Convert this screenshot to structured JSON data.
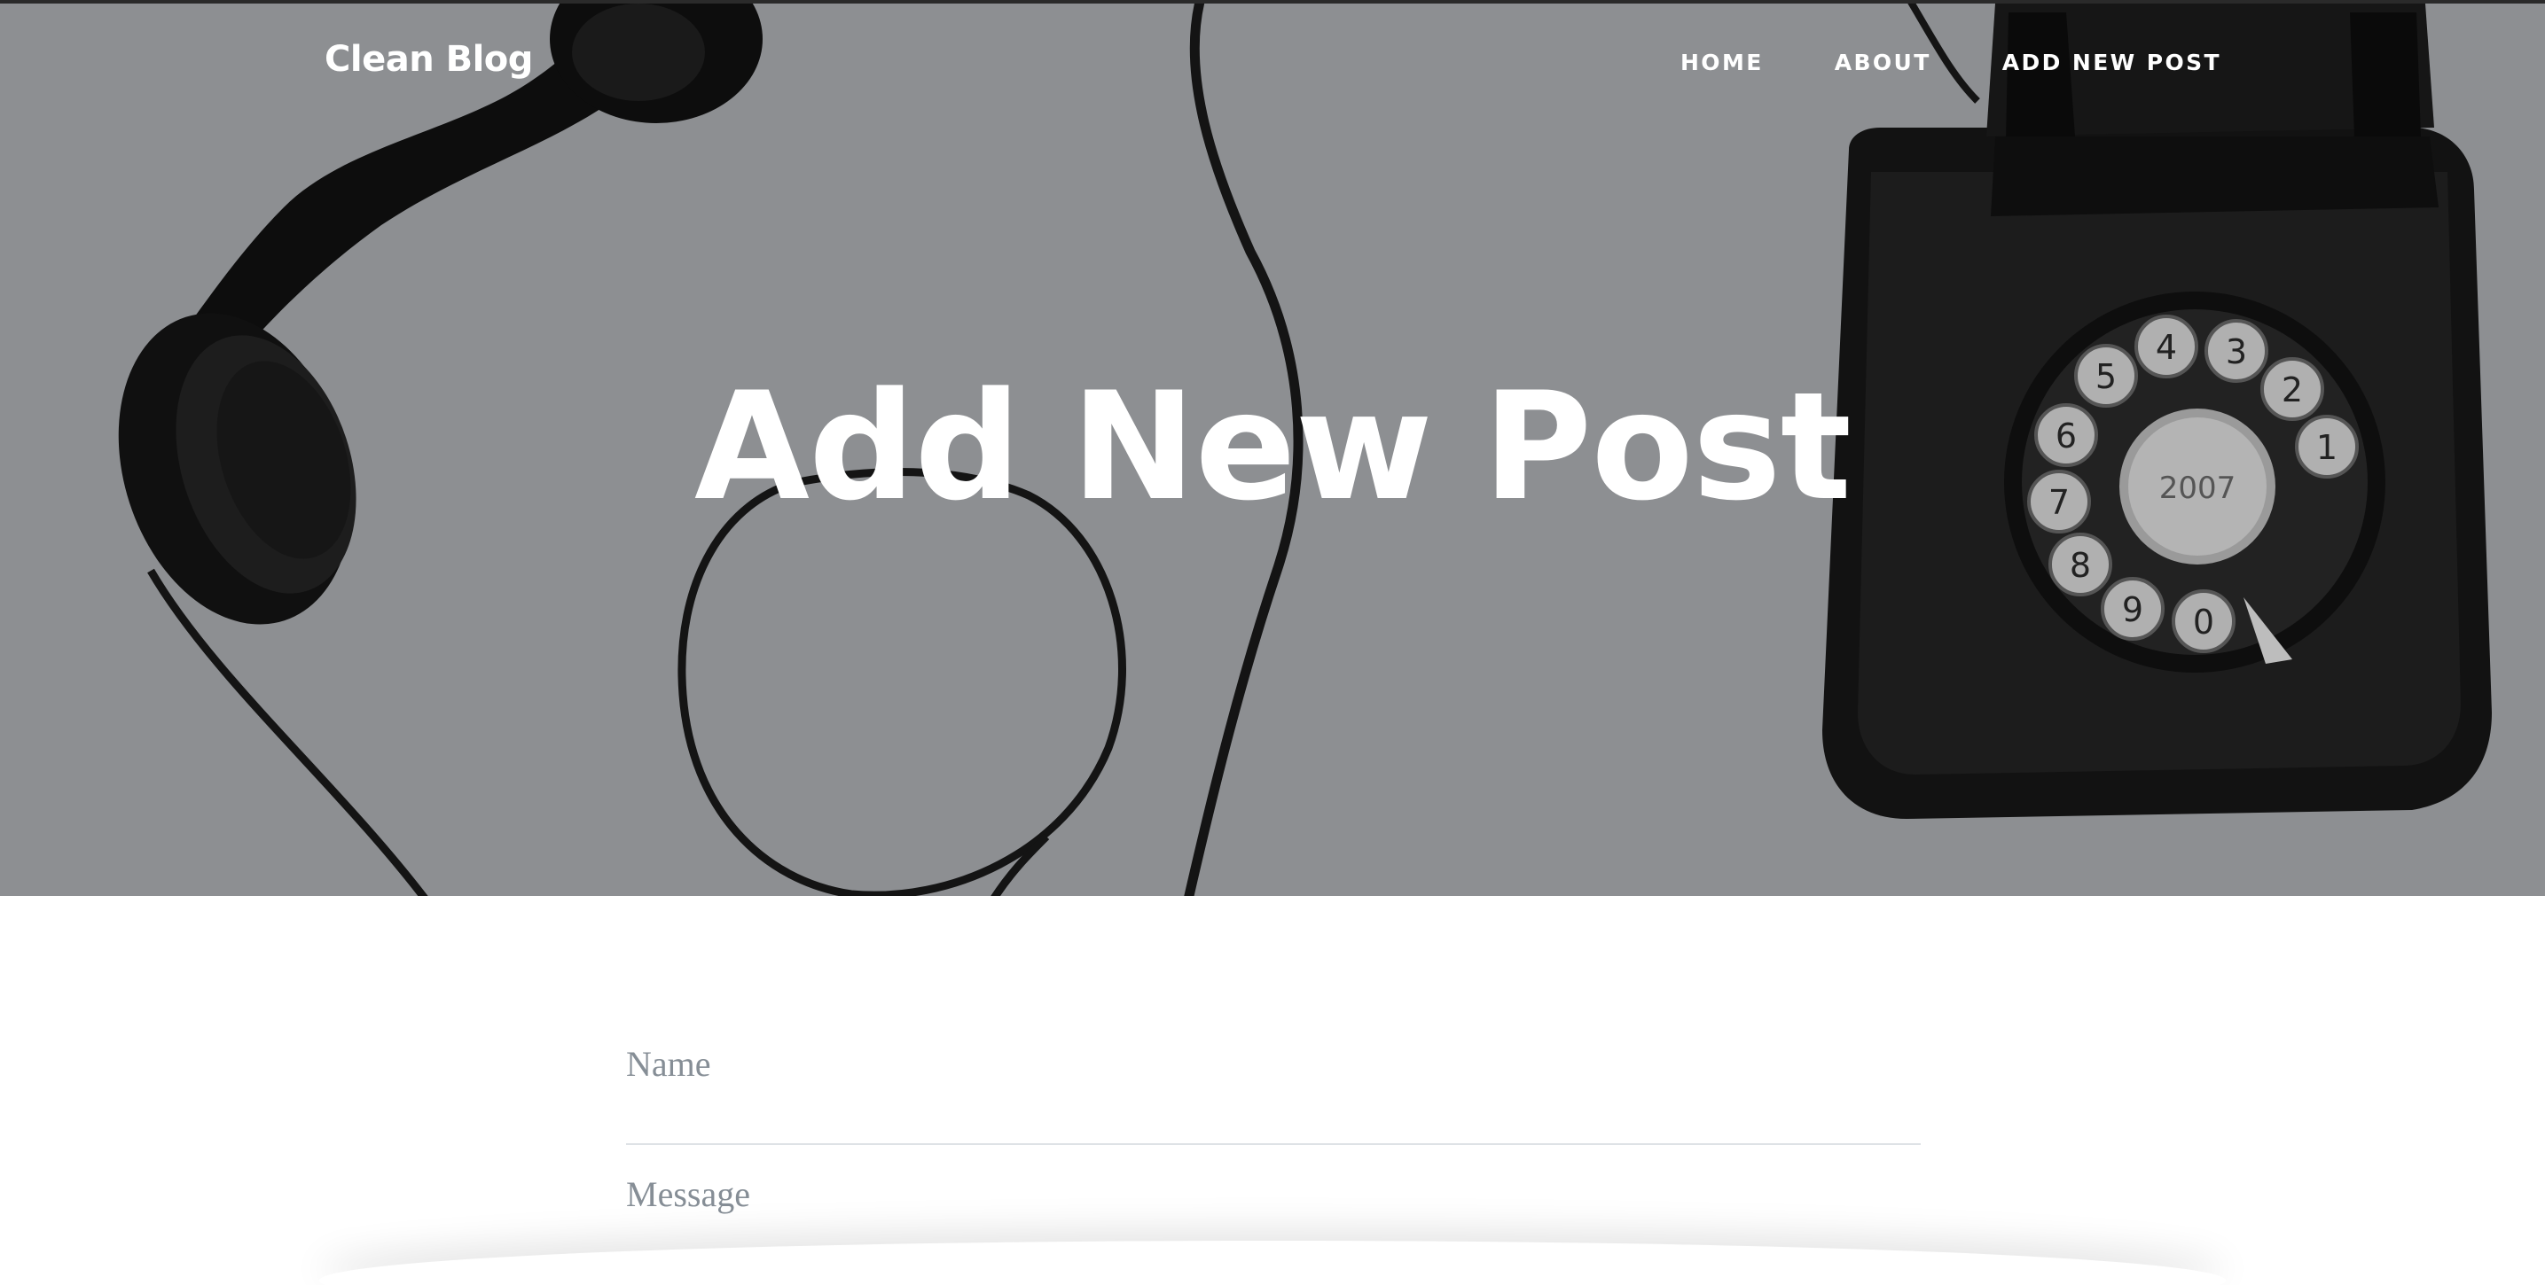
{
  "navbar": {
    "brand": "Clean Blog",
    "links": [
      {
        "label": "HOME"
      },
      {
        "label": "ABOUT"
      },
      {
        "label": "ADD NEW POST"
      }
    ]
  },
  "hero": {
    "title": "Add New Post",
    "background": "rotary-telephone-photo"
  },
  "form": {
    "name": {
      "placeholder": "Name",
      "value": ""
    },
    "message": {
      "placeholder": "Message",
      "value": ""
    }
  },
  "phone_dial": {
    "digits": [
      "1",
      "2",
      "3",
      "4",
      "5",
      "6",
      "7",
      "8",
      "9",
      "0"
    ],
    "center_text": "2007"
  },
  "colors": {
    "hero_overlay": "#8d8f92",
    "text_white": "#ffffff",
    "placeholder": "#868e96",
    "divider": "#dee2e6"
  }
}
